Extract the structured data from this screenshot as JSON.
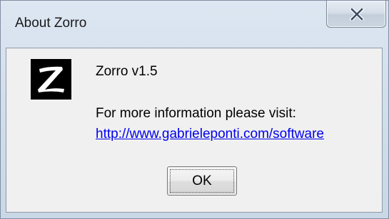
{
  "window": {
    "title": "About Zorro",
    "close_icon": "close-x-icon"
  },
  "logo": {
    "icon": "zorro-z-logo-icon",
    "background": "#000000",
    "foreground": "#ffffff"
  },
  "content": {
    "version_text": "Zorro v1.5",
    "info_text": "For more information please visit:",
    "link_text": "http://www.gabrieleponti.com/software"
  },
  "buttons": {
    "ok_label": "OK"
  },
  "colors": {
    "link": "#0000ee",
    "client_background": "#f0f0f0",
    "frame": "#d3dfec"
  }
}
